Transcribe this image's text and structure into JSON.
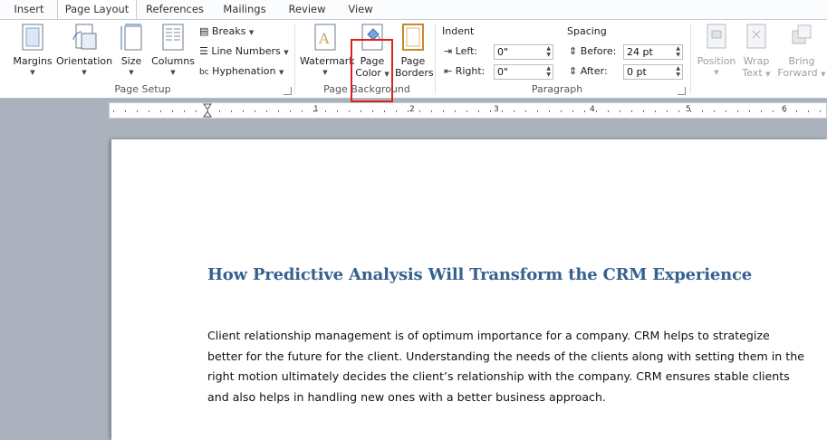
{
  "tabs": [
    {
      "label": "Insert",
      "active": false
    },
    {
      "label": "Page Layout",
      "active": true
    },
    {
      "label": "References",
      "active": false
    },
    {
      "label": "Mailings",
      "active": false
    },
    {
      "label": "Review",
      "active": false
    },
    {
      "label": "View",
      "active": false
    }
  ],
  "page_setup": {
    "group_label": "Page Setup",
    "margins": "Margins",
    "orientation": "Orientation",
    "size": "Size",
    "columns": "Columns",
    "breaks": "Breaks",
    "line_numbers": "Line Numbers",
    "hyphenation": "Hyphenation"
  },
  "page_background": {
    "group_label": "Page Background",
    "watermark": "Watermark",
    "page_color_line1": "Page",
    "page_color_line2": "Color",
    "page_borders_line1": "Page",
    "page_borders_line2": "Borders"
  },
  "paragraph": {
    "group_label": "Paragraph",
    "indent_label": "Indent",
    "left_label": "Left:",
    "left_value": "0\"",
    "right_label": "Right:",
    "right_value": "0\"",
    "spacing_label": "Spacing",
    "before_label": "Before:",
    "before_value": "24 pt",
    "after_label": "After:",
    "after_value": "0 pt"
  },
  "arrange": {
    "position": "Position",
    "wrap_text_line1": "Wrap",
    "wrap_text_line2": "Text",
    "bring_forward_line1": "Bring",
    "bring_forward_line2": "Forward"
  },
  "ruler": {
    "numbers": [
      "1",
      "2",
      "3",
      "4",
      "5",
      "6"
    ]
  },
  "document": {
    "title": "How Predictive Analysis Will Transform the CRM Experience",
    "paragraph_lines": [
      "Client relationship management is of optimum importance for a company. CRM helps to strategize",
      "better for the future for the client. Understanding  the needs of the clients along with setting them in the",
      "right motion ultimately decides the client’s relationship with the company. CRM ensures stable clients",
      "and also helps in handling new ones with a better business approach."
    ]
  },
  "colors": {
    "highlight": "#e02020",
    "title": "#36608f"
  }
}
